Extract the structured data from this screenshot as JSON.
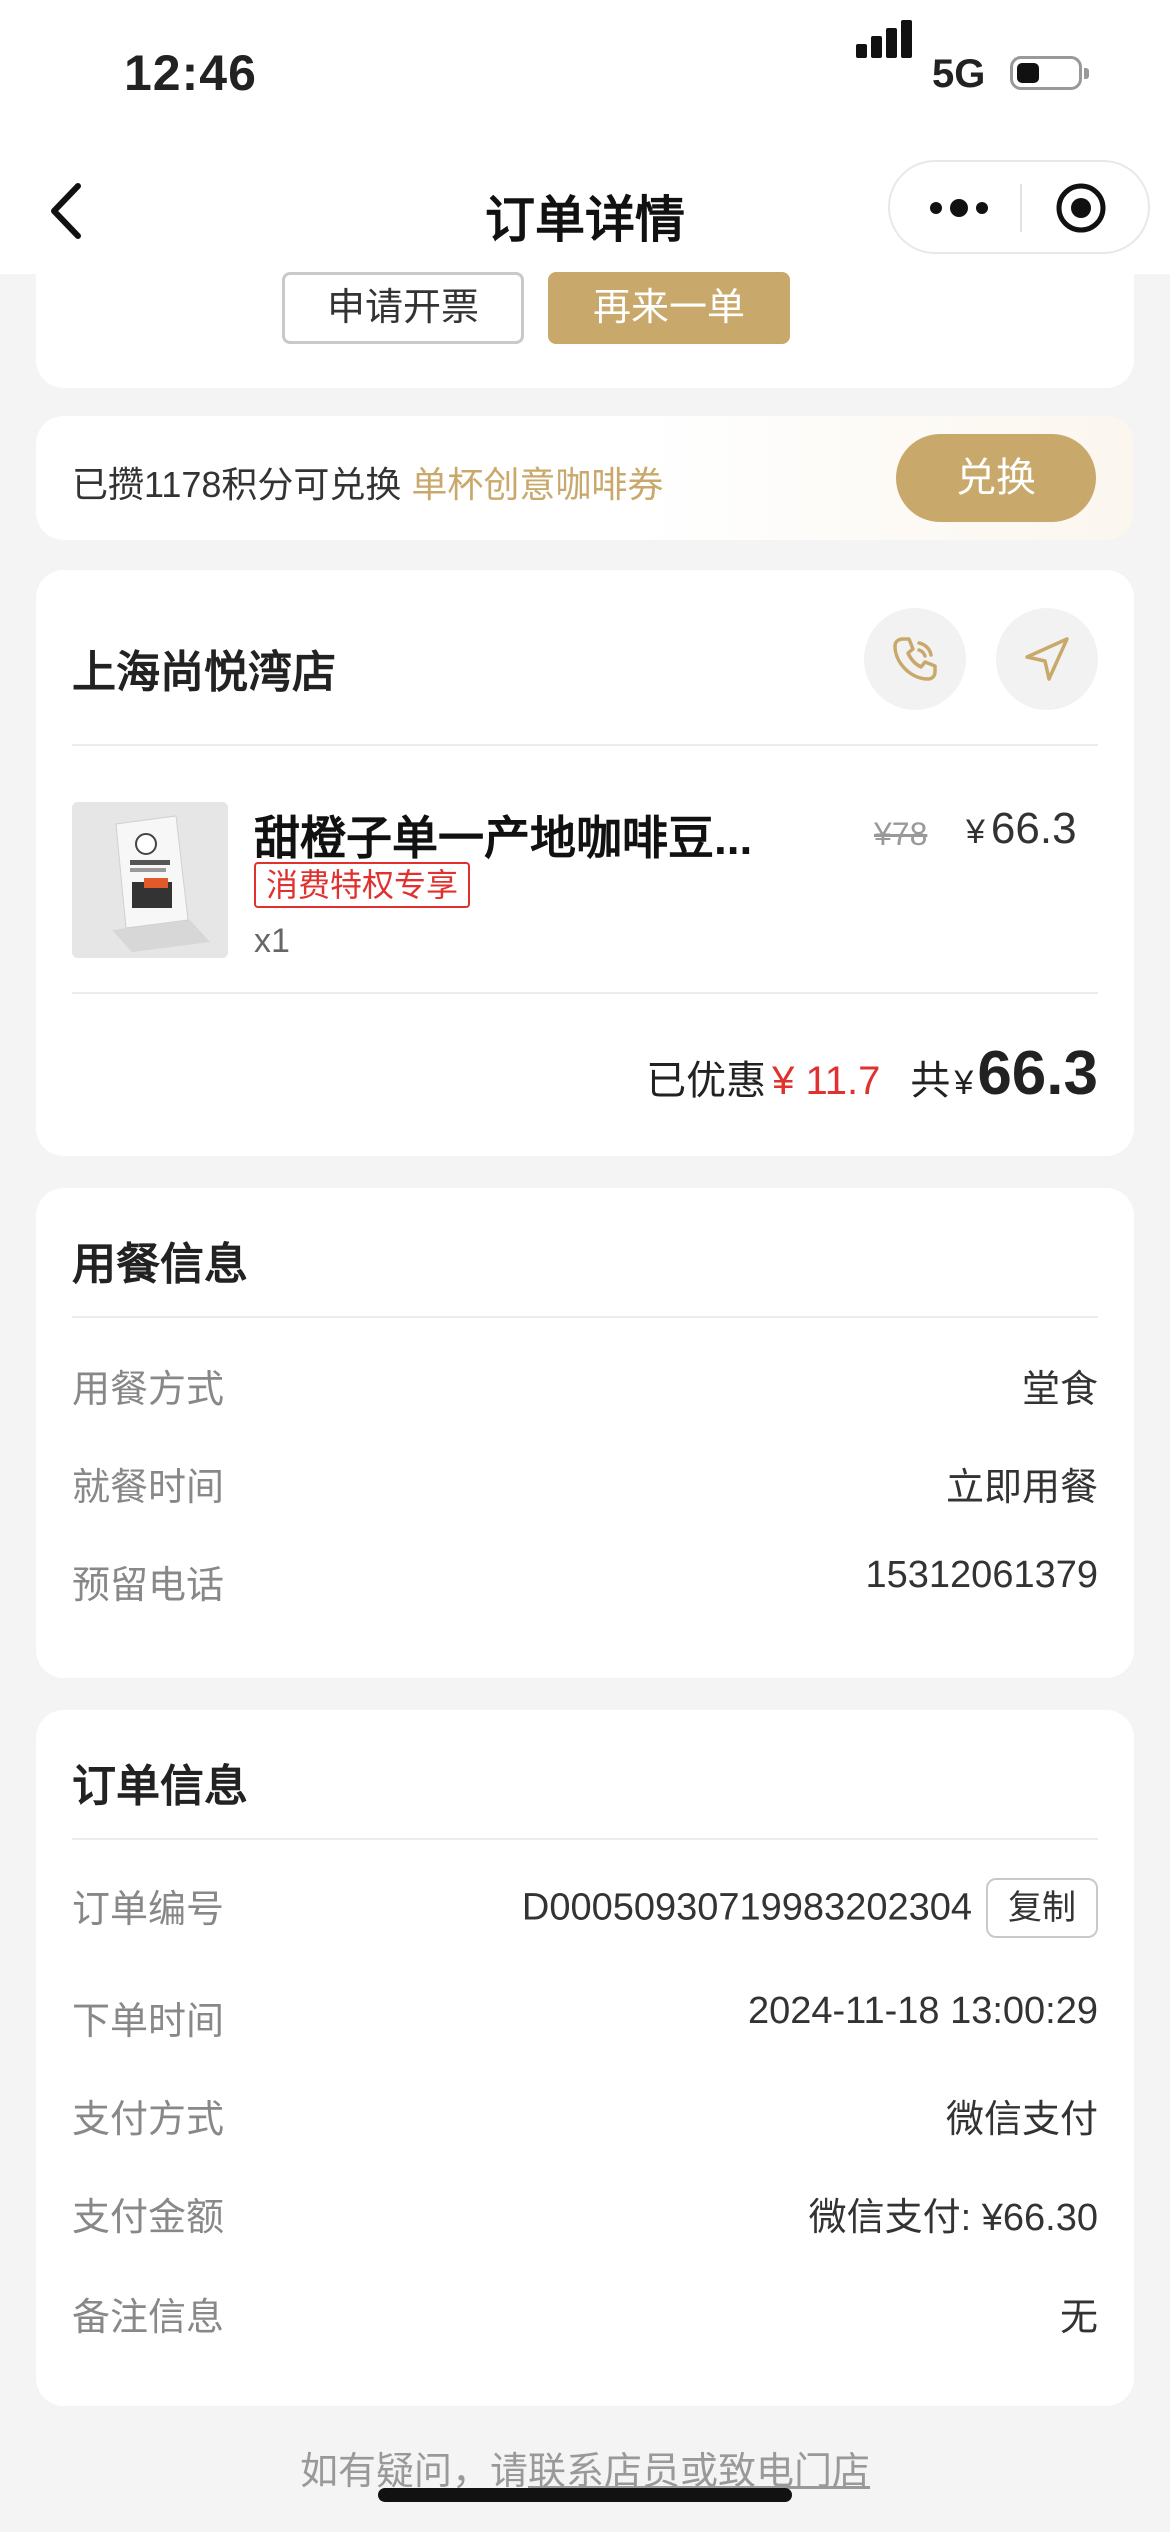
{
  "status_bar": {
    "time": "12:46",
    "network": "5G"
  },
  "nav": {
    "title": "订单详情"
  },
  "actions": {
    "invoice": "申请开票",
    "reorder": "再来一单"
  },
  "points": {
    "text": "已攒1178积分可兑换 ",
    "link": "单杯创意咖啡券",
    "button": "兑换"
  },
  "store": {
    "name": "上海尚悦湾店",
    "product": {
      "name": "甜橙子单一产地咖啡豆...",
      "tag": "消费特权专享",
      "qty": "x1",
      "original_price": "¥78",
      "currency": "¥",
      "price": "66.3"
    },
    "summary": {
      "discount_label": "已优惠",
      "discount": "¥ 11.7",
      "total_label": "共",
      "currency": "¥",
      "total": "66.3"
    }
  },
  "dining": {
    "title": "用餐信息",
    "rows": [
      {
        "label": "用餐方式",
        "value": "堂食"
      },
      {
        "label": "就餐时间",
        "value": "立即用餐"
      },
      {
        "label": "预留电话",
        "value": "15312061379"
      }
    ]
  },
  "order": {
    "title": "订单信息",
    "rows": [
      {
        "label": "订单编号",
        "value": "D00050930719983202304"
      },
      {
        "label": "下单时间",
        "value": "2024-11-18 13:00:29"
      },
      {
        "label": "支付方式",
        "value": "微信支付"
      },
      {
        "label": "支付金额",
        "value": "微信支付: ¥66.30"
      },
      {
        "label": "备注信息",
        "value": "无"
      }
    ],
    "copy_label": "复制"
  },
  "footer": {
    "text": "如有疑问，请",
    "link": "联系店员或致电门店"
  },
  "colors": {
    "accent": "#c9a96b",
    "discount": "#e0312e"
  }
}
